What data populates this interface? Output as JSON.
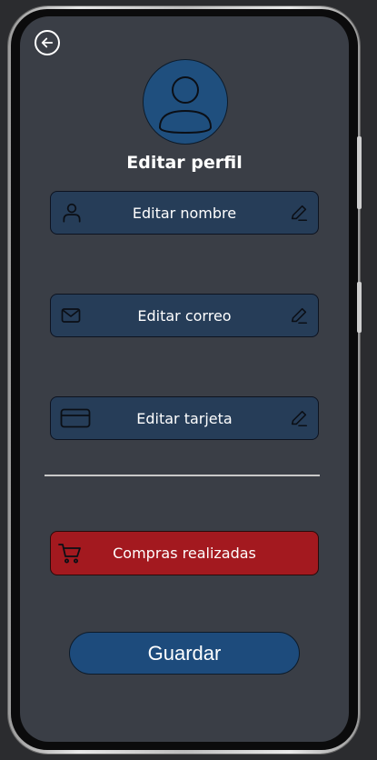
{
  "header": {
    "title": "Editar perfil"
  },
  "fields": [
    {
      "label": "Editar nombre",
      "icon": "user-icon"
    },
    {
      "label": "Editar correo",
      "icon": "mail-icon"
    },
    {
      "label": "Editar tarjeta",
      "icon": "credit-card-icon"
    }
  ],
  "orders_button": {
    "label": "Compras realizadas",
    "icon": "cart-icon"
  },
  "save_button": {
    "label": "Guardar"
  },
  "colors": {
    "background": "#3a3e46",
    "field": "#263d58",
    "primary": "#1d4b7c",
    "danger": "#a3191f"
  }
}
